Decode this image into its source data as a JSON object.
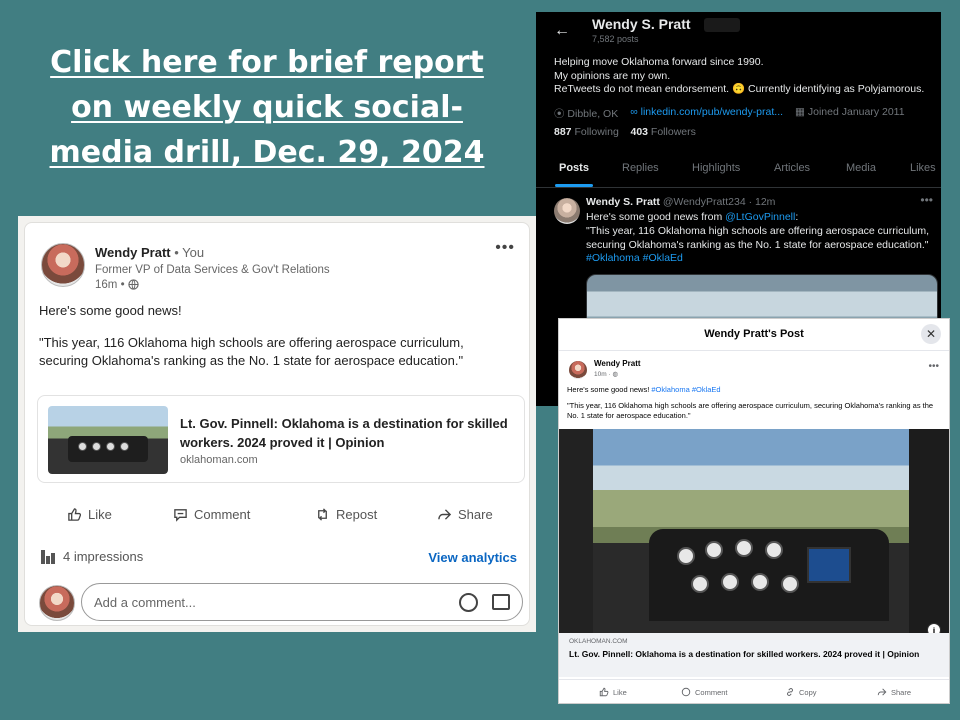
{
  "headline": {
    "line1": "Click here for brief report",
    "line2": "on weekly quick social-",
    "line3": "media drill, Dec. 29, 2024"
  },
  "linkedin": {
    "author": "Wendy Pratt",
    "relation": " • You",
    "title": "Former VP of Data Services & Gov't Relations",
    "time": "16m •",
    "text1": "Here's some good news!",
    "text2": "\"This year, 116 Oklahoma high schools are offering aerospace curriculum, securing Oklahoma's ranking as the No. 1 state for aerospace education.\"",
    "link_title": "Lt. Gov. Pinnell: Oklahoma is a destination for skilled workers. 2024 proved it | Opinion",
    "link_domain": "oklahoman.com",
    "actions": {
      "like": "Like",
      "comment": "Comment",
      "repost": "Repost",
      "share": "Share"
    },
    "impressions": "4 impressions",
    "view_analytics": "View analytics",
    "comment_placeholder": "Add a comment..."
  },
  "x": {
    "name": "Wendy S. Pratt",
    "posts_count": "7,582 posts",
    "bio1": "Helping move Oklahoma forward since 1990.",
    "bio2": "My opinions are my own.",
    "bio3": "ReTweets do not mean endorsement. 🙃 Currently identifying as Polyjamorous.",
    "location": "Dibble, OK",
    "link": "linkedin.com/pub/wendy-prat...",
    "joined": "Joined January 2011",
    "following_count": "887",
    "following_label": " Following",
    "followers_count": "403",
    "followers_label": " Followers",
    "tabs": [
      "Posts",
      "Replies",
      "Highlights",
      "Articles",
      "Media",
      "Likes"
    ],
    "tweet": {
      "name": "Wendy S. Pratt",
      "handle": " @WendyPratt234 · 12m",
      "text_prefix": "Here's some good news from ",
      "mention": "@LtGovPinnell",
      "text_suffix": ":",
      "quote": "\"This year, 116 Oklahoma high schools are offering aerospace curriculum, securing Oklahoma's ranking as the No. 1 state for aerospace education.\"",
      "tags": "#Oklahoma #OklaEd"
    }
  },
  "facebook": {
    "modal_title": "Wendy Pratt's Post",
    "author": "Wendy Pratt",
    "time": "10m ·",
    "text_prefix": "Here's some good news! ",
    "tags": "#Oklahoma  #OklaEd",
    "quote": "\"This year, 116 Oklahoma high schools are offering aerospace curriculum, securing Oklahoma's ranking as the No. 1 state for aerospace education.\"",
    "link_domain": "OKLAHOMAN.COM",
    "link_title": "Lt. Gov. Pinnell: Oklahoma is a destination for skilled workers. 2024 proved it | Opinion",
    "actions": {
      "like": "Like",
      "comment": "Comment",
      "copy": "Copy",
      "share": "Share"
    }
  },
  "colors": {
    "background": "#417e82",
    "linkedin_blue": "#0a66c2",
    "x_blue": "#1d9bf0",
    "facebook_blue": "#1877f2"
  }
}
